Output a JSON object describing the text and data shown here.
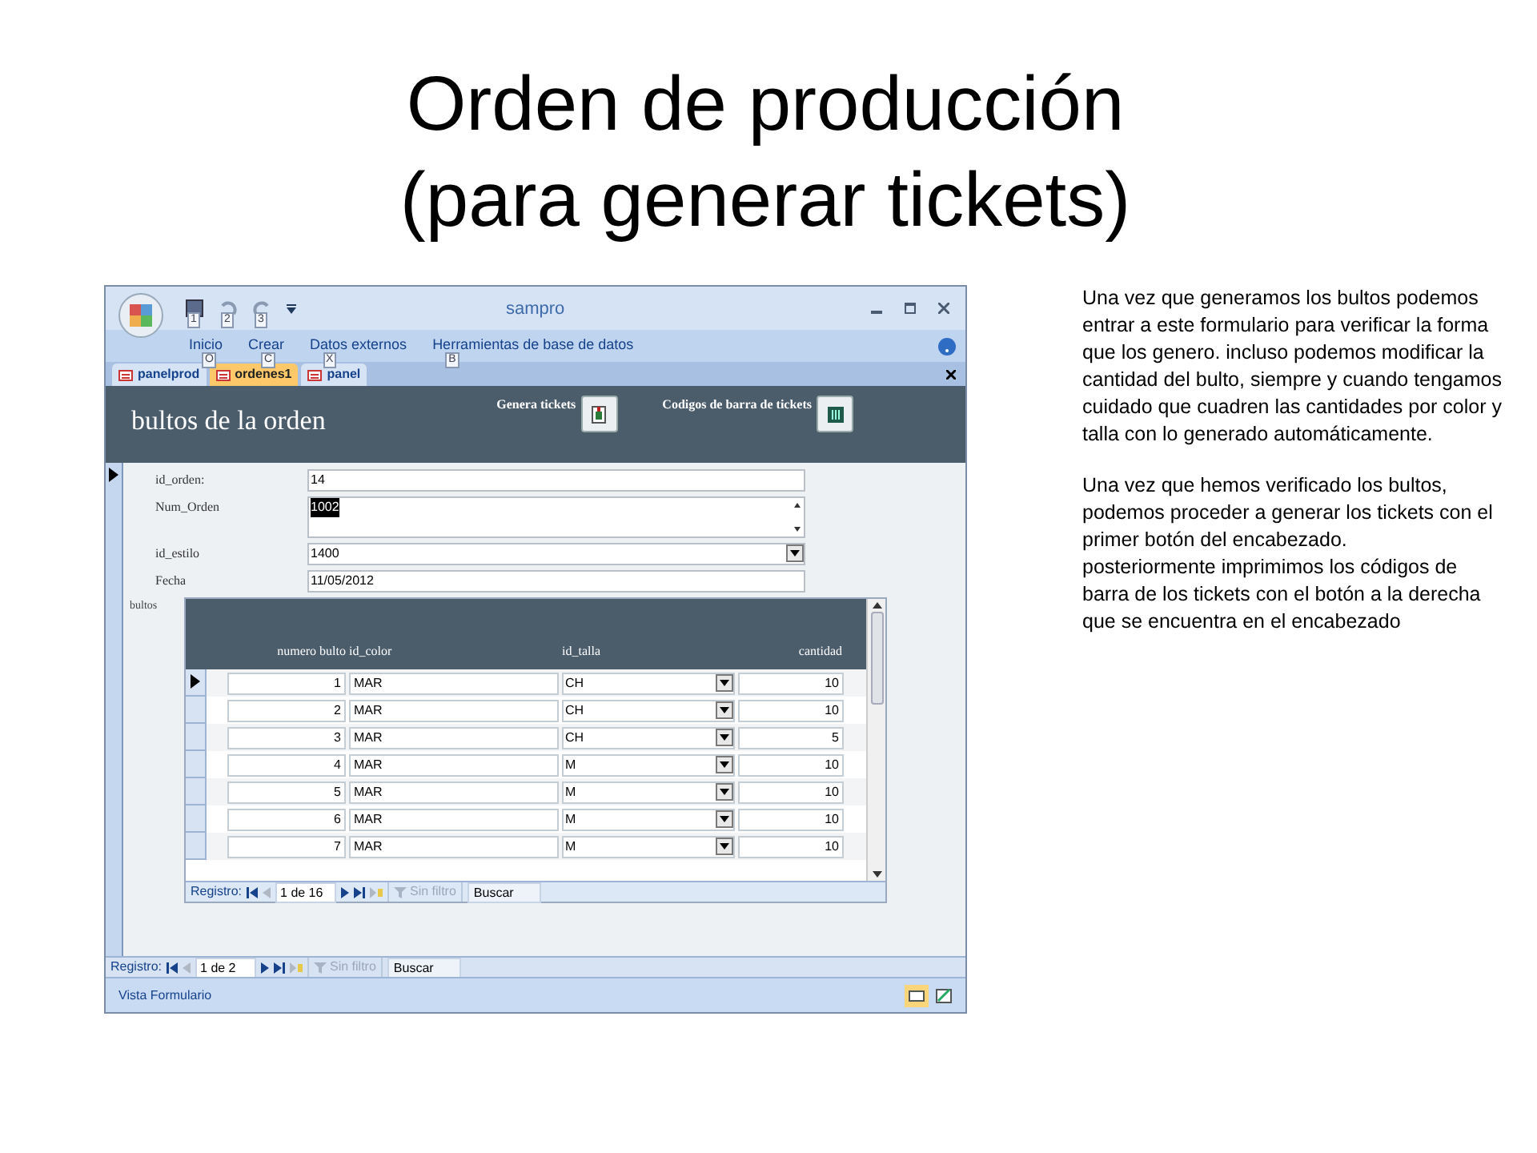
{
  "slide_title": [
    "Orden de producción",
    "(para generar tickets)"
  ],
  "window": {
    "title": "sampro",
    "quick_access_keytips": [
      "1",
      "2",
      "3"
    ]
  },
  "ribbon_tabs": [
    {
      "label": "Inicio",
      "keytip": "O"
    },
    {
      "label": "Crear",
      "keytip": "C"
    },
    {
      "label": "Datos externos",
      "keytip": "X"
    },
    {
      "label": "Herramientas de base de datos",
      "keytip": "B"
    }
  ],
  "document_tabs": [
    {
      "label": "panelprod",
      "selected": false
    },
    {
      "label": "ordenes1",
      "selected": true
    },
    {
      "label": "panel",
      "selected": false
    }
  ],
  "form": {
    "heading": "bultos de la orden",
    "header_buttons": [
      {
        "label": "Genera tickets",
        "kind": "tickets"
      },
      {
        "label": "Codigos de barra de tickets",
        "kind": "barcode"
      }
    ],
    "fields": [
      {
        "kind": "text",
        "label": "id_orden:",
        "value": "14",
        "text_selected": false
      },
      {
        "kind": "memo",
        "label": "Num_Orden",
        "value": "1002",
        "text_selected": true
      },
      {
        "kind": "combo",
        "label": "id_estilo",
        "value": "1400",
        "text_selected": false
      },
      {
        "kind": "text",
        "label": "Fecha",
        "value": "11/05/2012",
        "text_selected": false
      }
    ]
  },
  "subform": {
    "label": "bultos",
    "columns": [
      "numero bulto",
      "id_color",
      "id_talla",
      "cantidad"
    ],
    "rows": [
      {
        "cells": [
          "1",
          "MAR",
          "CH",
          "10"
        ],
        "current": true
      },
      {
        "cells": [
          "2",
          "MAR",
          "CH",
          "10"
        ],
        "current": false
      },
      {
        "cells": [
          "3",
          "MAR",
          "CH",
          "5"
        ],
        "current": false
      },
      {
        "cells": [
          "4",
          "MAR",
          "M",
          "10"
        ],
        "current": false
      },
      {
        "cells": [
          "5",
          "MAR",
          "M",
          "10"
        ],
        "current": false
      },
      {
        "cells": [
          "6",
          "MAR",
          "M",
          "10"
        ],
        "current": false
      },
      {
        "cells": [
          "7",
          "MAR",
          "M",
          "10"
        ],
        "current": false
      }
    ],
    "navigation": {
      "label": "Registro:",
      "position": "1 de 16",
      "filter": "Sin filtro",
      "search": "Buscar"
    }
  },
  "navigation": {
    "label": "Registro:",
    "position": "1 de 2",
    "filter": "Sin filtro",
    "search": "Buscar"
  },
  "status_bar": "Vista Formulario",
  "notes": [
    [
      "Una vez que generamos los bultos podemos entrar a este formulario para verificar la forma que los genero. incluso podemos modificar la cantidad del bulto, siempre y cuando tengamos cuidado que cuadren  las cantidades por color y talla con lo generado automáticamente."
    ],
    [
      "Una vez que hemos verificado los bultos, podemos proceder a generar los tickets con el primer botón del encabezado.",
      "posteriormente imprimimos los códigos de barra de los tickets con el botón a la derecha que se encuentra en el encabezado"
    ]
  ]
}
